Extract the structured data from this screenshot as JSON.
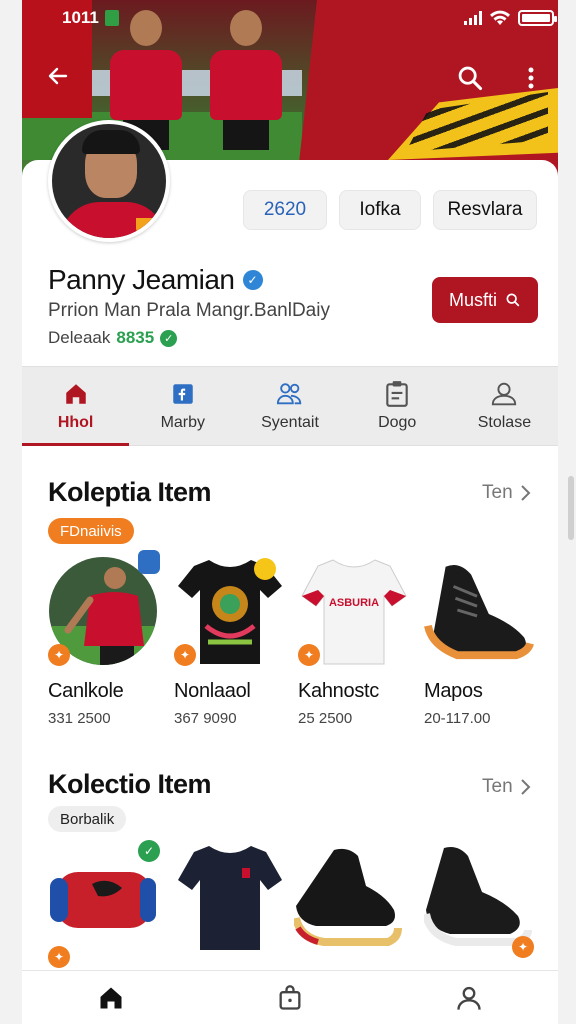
{
  "status_bar": {
    "time": "1011"
  },
  "profile": {
    "name": "Panny Jeamian",
    "subtitle": "Prrion Man Prala Mangr.BanlDaiy",
    "meta_label": "Deleaak",
    "meta_value": "8835",
    "stats": [
      "2620",
      "Iofka",
      "Resvlara"
    ],
    "message_label": "Musfti"
  },
  "tabs": [
    {
      "label": "Hhol",
      "icon": "home-icon",
      "active": true
    },
    {
      "label": "Marby",
      "icon": "bookmark-icon",
      "active": false
    },
    {
      "label": "Syentait",
      "icon": "people-icon",
      "active": false
    },
    {
      "label": "Dogo",
      "icon": "clipboard-icon",
      "active": false
    },
    {
      "label": "Stolase",
      "icon": "store-icon",
      "active": false
    }
  ],
  "section1": {
    "title": "Koleptia Item",
    "see_all": "Ten",
    "chip": "FDnaiivis",
    "items": [
      {
        "name": "Canlkole",
        "price": "331 2500"
      },
      {
        "name": "Nonlaaol",
        "price": "367 9090"
      },
      {
        "name": "Kahnostc",
        "price": "25 2500"
      },
      {
        "name": "Mapos",
        "price": "20-117.00"
      }
    ]
  },
  "section2": {
    "title": "Kolectio Item",
    "see_all": "Ten",
    "chip": "Borbalik"
  },
  "jersey_print": "ASBURIA",
  "colors": {
    "accent": "#b01622",
    "orange": "#f07d1f",
    "green": "#2aa050"
  }
}
